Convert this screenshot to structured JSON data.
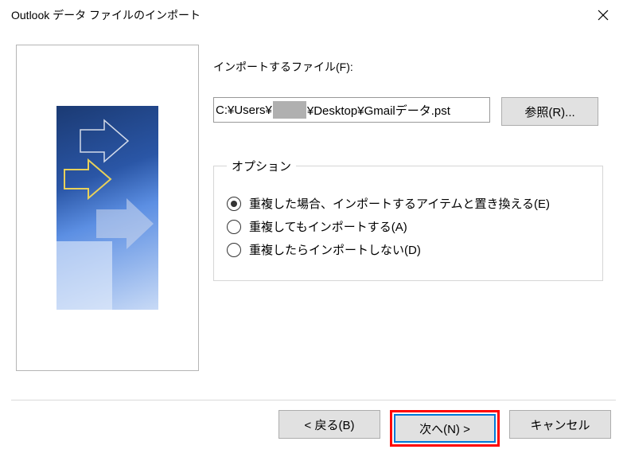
{
  "titlebar": {
    "title": "Outlook データ ファイルのインポート"
  },
  "main": {
    "file_label": "インポートするファイル(F):",
    "file_path_prefix": "C:¥Users¥",
    "file_path_suffix": "¥Desktop¥Gmailデータ.pst",
    "browse_label": "参照(R)..."
  },
  "options": {
    "legend": "オプション",
    "items": [
      {
        "label": "重複した場合、インポートするアイテムと置き換える(E)",
        "checked": true
      },
      {
        "label": "重複してもインポートする(A)",
        "checked": false
      },
      {
        "label": "重複したらインポートしない(D)",
        "checked": false
      }
    ]
  },
  "buttons": {
    "back": "< 戻る(B)",
    "next": "次へ(N) >",
    "cancel": "キャンセル"
  }
}
